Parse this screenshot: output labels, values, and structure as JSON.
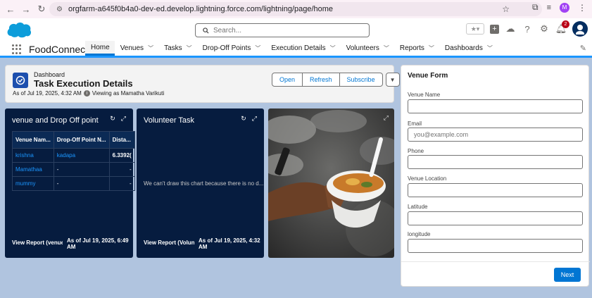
{
  "browser": {
    "url": "orgfarm-a645f0b4a0-dev-ed.develop.lightning.force.com/lightning/page/home",
    "profile_initial": "M"
  },
  "header": {
    "search_placeholder": "Search...",
    "notification_count": "2"
  },
  "nav": {
    "app_name": "FoodConnect",
    "items": [
      {
        "label": "Home"
      },
      {
        "label": "Venues"
      },
      {
        "label": "Tasks"
      },
      {
        "label": "Drop-Off Points"
      },
      {
        "label": "Execution Details"
      },
      {
        "label": "Volunteers"
      },
      {
        "label": "Reports"
      },
      {
        "label": "Dashboards"
      }
    ]
  },
  "dashboard": {
    "type_label": "Dashboard",
    "title": "Task Execution Details",
    "as_of": "As of Jul 19, 2025, 4:32 AM",
    "viewing_as": "Viewing as Mamatha Varikuti",
    "buttons": {
      "open": "Open",
      "refresh": "Refresh",
      "subscribe": "Subscribe"
    }
  },
  "widget1": {
    "title": "venue and Drop Off point",
    "columns": [
      "Venue Nam...",
      "Drop-Off Point N...",
      "Dista..."
    ],
    "rows": [
      [
        "krishna",
        "kadapa",
        "6.3392("
      ],
      [
        "Mamathaa",
        "-",
        "-"
      ],
      [
        "mummy",
        "-",
        "-"
      ]
    ],
    "footer_link": "View Report (venue ...",
    "footer_time_1": "As of Jul 19, 2025, 6:49",
    "footer_time_2": "AM"
  },
  "widget2": {
    "title": "Volunteer Task",
    "message": "We can't draw this chart because there is no d...",
    "footer_link": "View Report (Volunt...",
    "footer_time_1": "As of Jul 19, 2025, 4:32",
    "footer_time_2": "AM"
  },
  "venue_form": {
    "title": "Venue Form",
    "fields": [
      {
        "label": "Venue Name",
        "placeholder": ""
      },
      {
        "label": "Email",
        "placeholder": "you@example.com"
      },
      {
        "label": "Phone",
        "placeholder": ""
      },
      {
        "label": "Venue Location",
        "placeholder": ""
      },
      {
        "label": "Latitude",
        "placeholder": ""
      },
      {
        "label": "longitude",
        "placeholder": ""
      }
    ],
    "next_label": "Next"
  },
  "colors": {
    "brand": "#0176d3",
    "widget_bg": "#061c3f",
    "page_bg": "#b0c4df"
  }
}
